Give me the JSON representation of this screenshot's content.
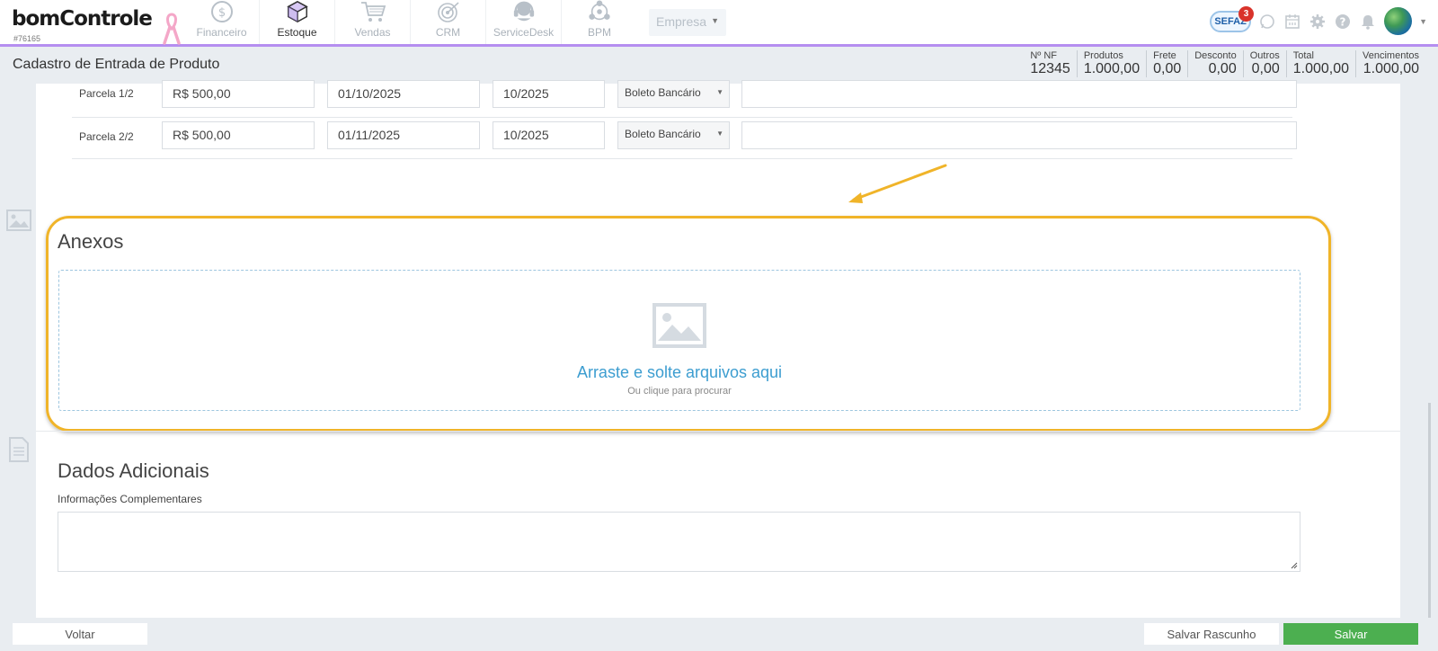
{
  "brand": {
    "logo_text": "bomControle",
    "account_id": "#76165"
  },
  "nav": {
    "items": [
      {
        "label": "Financeiro",
        "icon": "dollar-circle-icon"
      },
      {
        "label": "Estoque",
        "icon": "cube-icon"
      },
      {
        "label": "Vendas",
        "icon": "cart-icon"
      },
      {
        "label": "CRM",
        "icon": "target-icon"
      },
      {
        "label": "ServiceDesk",
        "icon": "headset-icon"
      },
      {
        "label": "BPM",
        "icon": "network-icon"
      }
    ],
    "active": "Estoque",
    "company_select": "Empresa"
  },
  "top_right": {
    "sefaz_label": "SEFAZ",
    "sefaz_badge": "3"
  },
  "header": {
    "title": "Cadastro de Entrada de Produto",
    "summary": [
      {
        "label": "Nº NF",
        "value": "12345"
      },
      {
        "label": "Produtos",
        "value": "1.000,00"
      },
      {
        "label": "Frete",
        "value": "0,00"
      },
      {
        "label": "Desconto",
        "value": "0,00"
      },
      {
        "label": "Outros",
        "value": "0,00"
      },
      {
        "label": "Total",
        "value": "1.000,00"
      },
      {
        "label": "Vencimentos",
        "value": "1.000,00"
      }
    ]
  },
  "parcelas": [
    {
      "label": "Parcela 1/2",
      "valor": "R$ 500,00",
      "vencimento": "01/10/2025",
      "competencia": "10/2025",
      "forma": "Boleto Bancário",
      "obs": ""
    },
    {
      "label": "Parcela 2/2",
      "valor": "R$ 500,00",
      "vencimento": "01/11/2025",
      "competencia": "10/2025",
      "forma": "Boleto Bancário",
      "obs": ""
    }
  ],
  "anexos": {
    "title": "Anexos",
    "drop_title": "Arraste e solte arquivos aqui",
    "drop_sub": "Ou clique para procurar"
  },
  "dados": {
    "title": "Dados Adicionais",
    "info_label": "Informações Complementares",
    "info_value": ""
  },
  "footer": {
    "voltar": "Voltar",
    "rascunho": "Salvar Rascunho",
    "salvar": "Salvar"
  },
  "colors": {
    "accent_purple": "#b58ef0",
    "highlight": "#f0b429",
    "link_blue": "#3c9dd0",
    "save_green": "#4caf50"
  }
}
